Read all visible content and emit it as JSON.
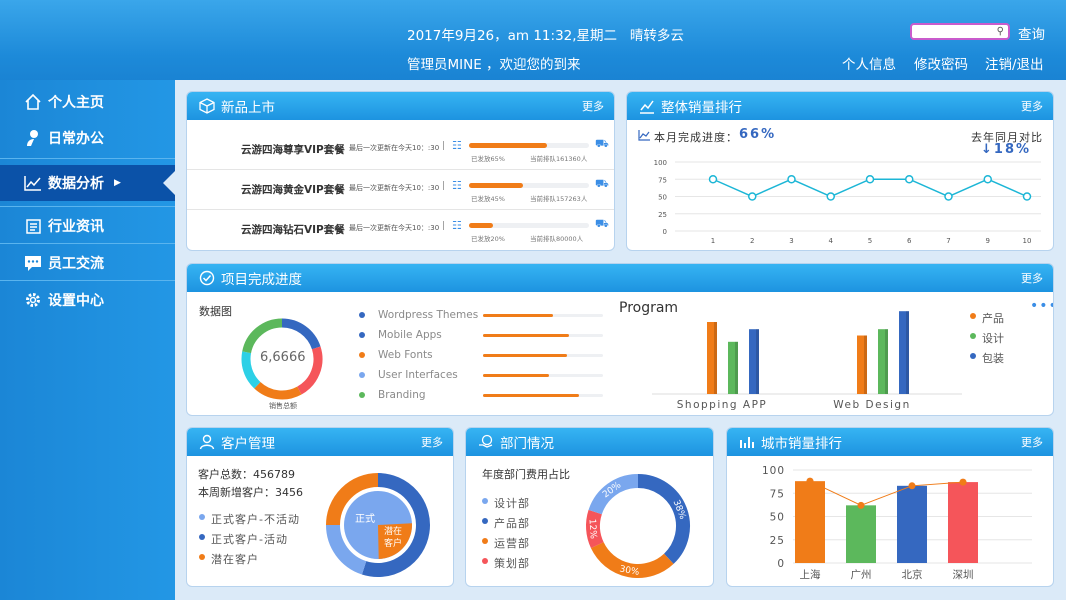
{
  "header": {
    "datetime": "2017年9月26，am 11:32,星期二",
    "weather": "晴转多云",
    "welcome": "管理员MINE ，欢迎您的到来",
    "search_placeholder": "",
    "search_btn": "查询",
    "links": [
      "个人信息",
      "修改密码",
      "注销/退出"
    ]
  },
  "sidebar": {
    "items": [
      {
        "label": "个人主页",
        "icon": "home-icon"
      },
      {
        "label": "日常办公",
        "icon": "user-icon"
      },
      {
        "label": "数据分析",
        "icon": "chart-icon",
        "active": true
      },
      {
        "label": "行业资讯",
        "icon": "news-icon"
      },
      {
        "label": "员工交流",
        "icon": "chat-icon"
      },
      {
        "label": "设置中心",
        "icon": "gear-icon"
      }
    ]
  },
  "colors": {
    "header": "#1d8ad9",
    "active": "#0b52a8",
    "orange": "#f07c18",
    "green": "#5cb85c",
    "blue": "#3568c0",
    "red": "#f5555a",
    "cyan": "#1cb6d6"
  },
  "more": "更多",
  "new_products": {
    "title": "新品上市",
    "rows": [
      {
        "name": "云游四海尊享VIP套餐",
        "update": "最后一次更新在今天10：:30",
        "sent": "已发放65%",
        "queue": "当前排队161360人",
        "pct": 0.65
      },
      {
        "name": "云游四海黄金VIP套餐",
        "update": "最后一次更新在今天10：:30",
        "sent": "已发放45%",
        "queue": "当前排队157263人",
        "pct": 0.45
      },
      {
        "name": "云游四海钻石VIP套餐",
        "update": "最后一次更新在今天10：:30",
        "sent": "已发放20%",
        "queue": "当前排队80000人",
        "pct": 0.2
      }
    ]
  },
  "sales_rank": {
    "title": "整体销量排行",
    "progress_label": "本月完成进度：",
    "progress": "66%",
    "yoy_label": "去年同月对比",
    "yoy": "↓18%",
    "chart_data": {
      "type": "line",
      "x": [
        "1",
        "2",
        "3",
        "4",
        "5",
        "6",
        "7",
        "9",
        "10"
      ],
      "values": [
        75,
        50,
        75,
        50,
        75,
        75,
        50,
        75,
        50
      ],
      "ylim": [
        0,
        100
      ],
      "yticks": [
        "0",
        "25",
        "50",
        "75",
        "100"
      ]
    }
  },
  "projects": {
    "title": "项目完成进度",
    "donut_label": "数据图",
    "donut_value": "6,6666",
    "donut_caption": "销售总额",
    "donut_segments": [
      {
        "color": "#3568c0",
        "value": 0.2
      },
      {
        "color": "#f5555a",
        "value": 0.22
      },
      {
        "color": "#f07c18",
        "value": 0.2
      },
      {
        "color": "#2dd0e6",
        "value": 0.16
      },
      {
        "color": "#5cb85c",
        "value": 0.22
      }
    ],
    "items": [
      {
        "label": "Wordpress Themes",
        "color": "#3568c0",
        "pct": 0.58
      },
      {
        "label": "Mobile Apps",
        "color": "#3568c0",
        "pct": 0.72
      },
      {
        "label": "Web Fonts",
        "color": "#f07c18",
        "pct": 0.7
      },
      {
        "label": "User Interfaces",
        "color": "#7aa7ee",
        "pct": 0.55
      },
      {
        "label": "Branding",
        "color": "#5cb85c",
        "pct": 0.8
      }
    ],
    "program": {
      "title": "Program",
      "legend": [
        "产品",
        "设计",
        "包装"
      ],
      "chart_data": {
        "type": "bar",
        "categories": [
          "Shopping APP",
          "Web Design"
        ],
        "series": [
          {
            "name": "产品",
            "values": [
              80,
              65
            ]
          },
          {
            "name": "设计",
            "values": [
              58,
              72
            ]
          },
          {
            "name": "包装",
            "values": [
              72,
              92
            ]
          }
        ],
        "ylim": [
          0,
          100
        ]
      }
    }
  },
  "customers": {
    "title": "客户管理",
    "total": "客户总数：456789",
    "new": "本周新增客户：3456",
    "legend": [
      "正式客户-不活动",
      "正式客户-活动",
      "潜在客户"
    ],
    "pie_labels": [
      "正式",
      "潜在客户"
    ],
    "chart_data": {
      "type": "pie",
      "categories": [
        "正式客户-不活动",
        "正式客户-活动",
        "潜在客户"
      ],
      "values": [
        55,
        20,
        25
      ]
    }
  },
  "departments": {
    "title": "部门情况",
    "subtitle": "年度部门费用占比",
    "legend": [
      "设计部",
      "产品部",
      "运营部",
      "策划部"
    ],
    "chart_data": {
      "type": "pie",
      "categories": [
        "产品部",
        "运营部",
        "策划部",
        "设计部"
      ],
      "values": [
        38,
        30,
        12,
        20
      ],
      "labels": [
        "38%",
        "30%",
        "12%",
        "20%"
      ]
    }
  },
  "city_sales": {
    "title": "城市销量排行",
    "chart_data": {
      "type": "bar",
      "categories": [
        "上海",
        "广州",
        "北京",
        "深圳"
      ],
      "values": [
        88,
        62,
        83,
        87
      ],
      "ylim": [
        0,
        100
      ],
      "yticks": [
        "0",
        "25",
        "50",
        "75",
        "100"
      ]
    }
  }
}
